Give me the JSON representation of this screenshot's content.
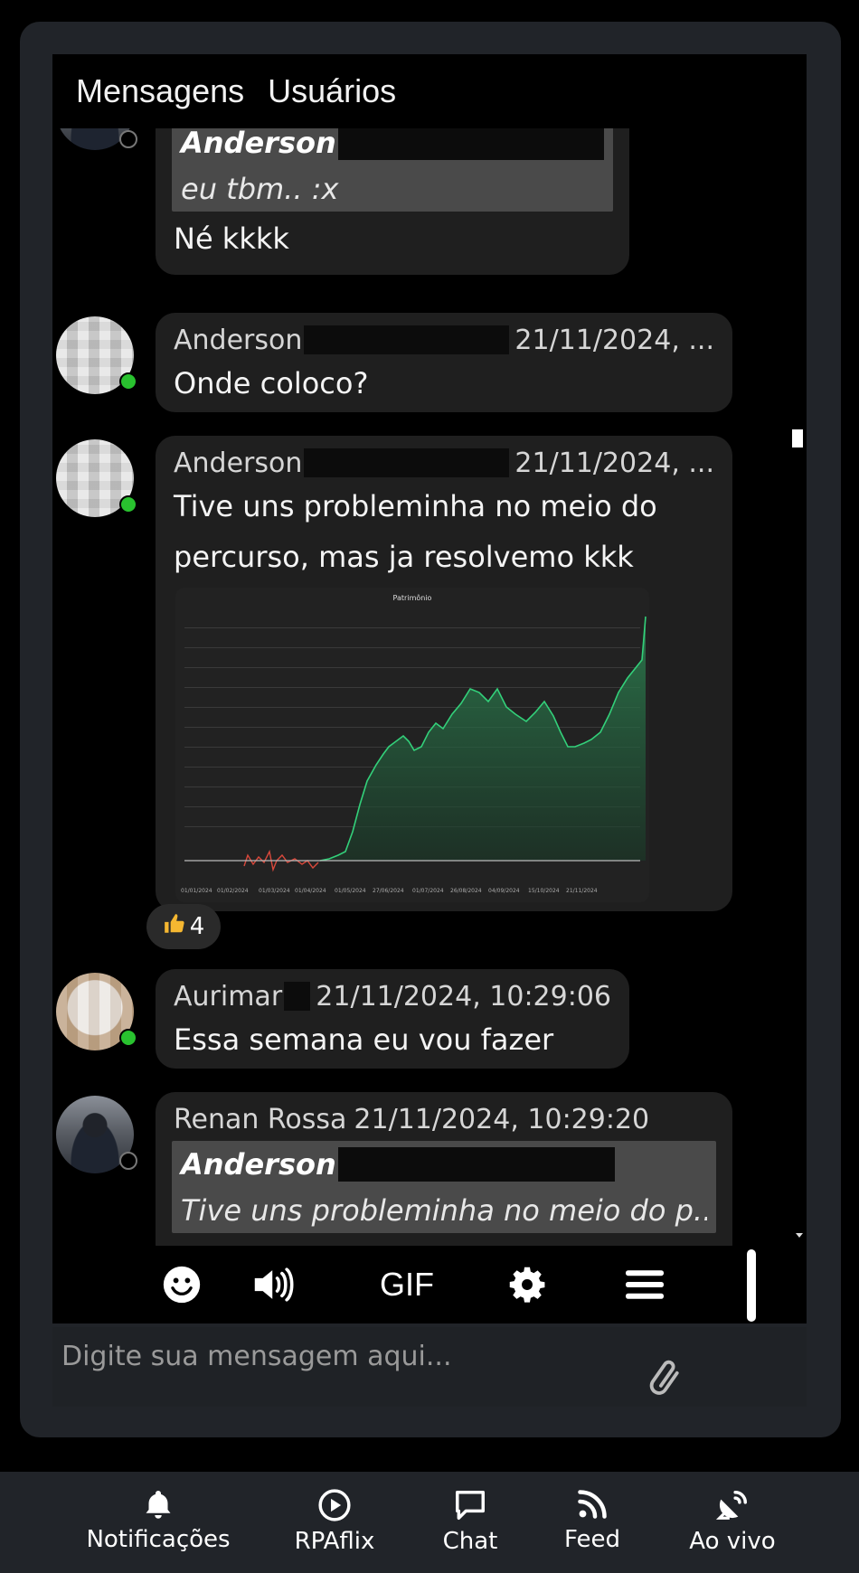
{
  "tabs": [
    "Mensagens",
    "Usuários"
  ],
  "messages": [
    {
      "quote_name": "Anderson",
      "quote_text": "eu tbm.. :x",
      "text": "Né kkkk"
    },
    {
      "author": "Anderson",
      "timestamp": "21/11/2024, ...",
      "text": "Onde coloco?"
    },
    {
      "author": "Anderson",
      "timestamp": "21/11/2024, ...",
      "text_line1": "Tive uns probleminha no meio do",
      "text_line2": "percurso, mas ja resolvemo kkk",
      "image_title": "Patrimônio",
      "reaction_count": "4"
    },
    {
      "author": "Aurimar",
      "timestamp": "21/11/2024, 10:29:06",
      "text": "Essa semana eu vou fazer"
    },
    {
      "author": "Renan Rossa",
      "timestamp": "21/11/2024, 10:29:20",
      "quote_name": "Anderson",
      "quote_text": "Tive uns probleminha no meio do p..."
    }
  ],
  "toolbar": {
    "gif_label": "GIF"
  },
  "input": {
    "placeholder": "Digite sua mensagem aqui..."
  },
  "nav": [
    {
      "label": "Notificações",
      "icon": "bell-icon"
    },
    {
      "label": "RPAflix",
      "icon": "play-circle-icon"
    },
    {
      "label": "Chat",
      "icon": "chat-bubble-icon"
    },
    {
      "label": "Feed",
      "icon": "rss-icon"
    },
    {
      "label": "Ao vivo",
      "icon": "satellite-dish-icon"
    }
  ],
  "colors": {
    "online": "#29c22f",
    "chart_positive": "#2fbf6b",
    "chart_negative": "#d9483b",
    "panel": "#212429"
  }
}
